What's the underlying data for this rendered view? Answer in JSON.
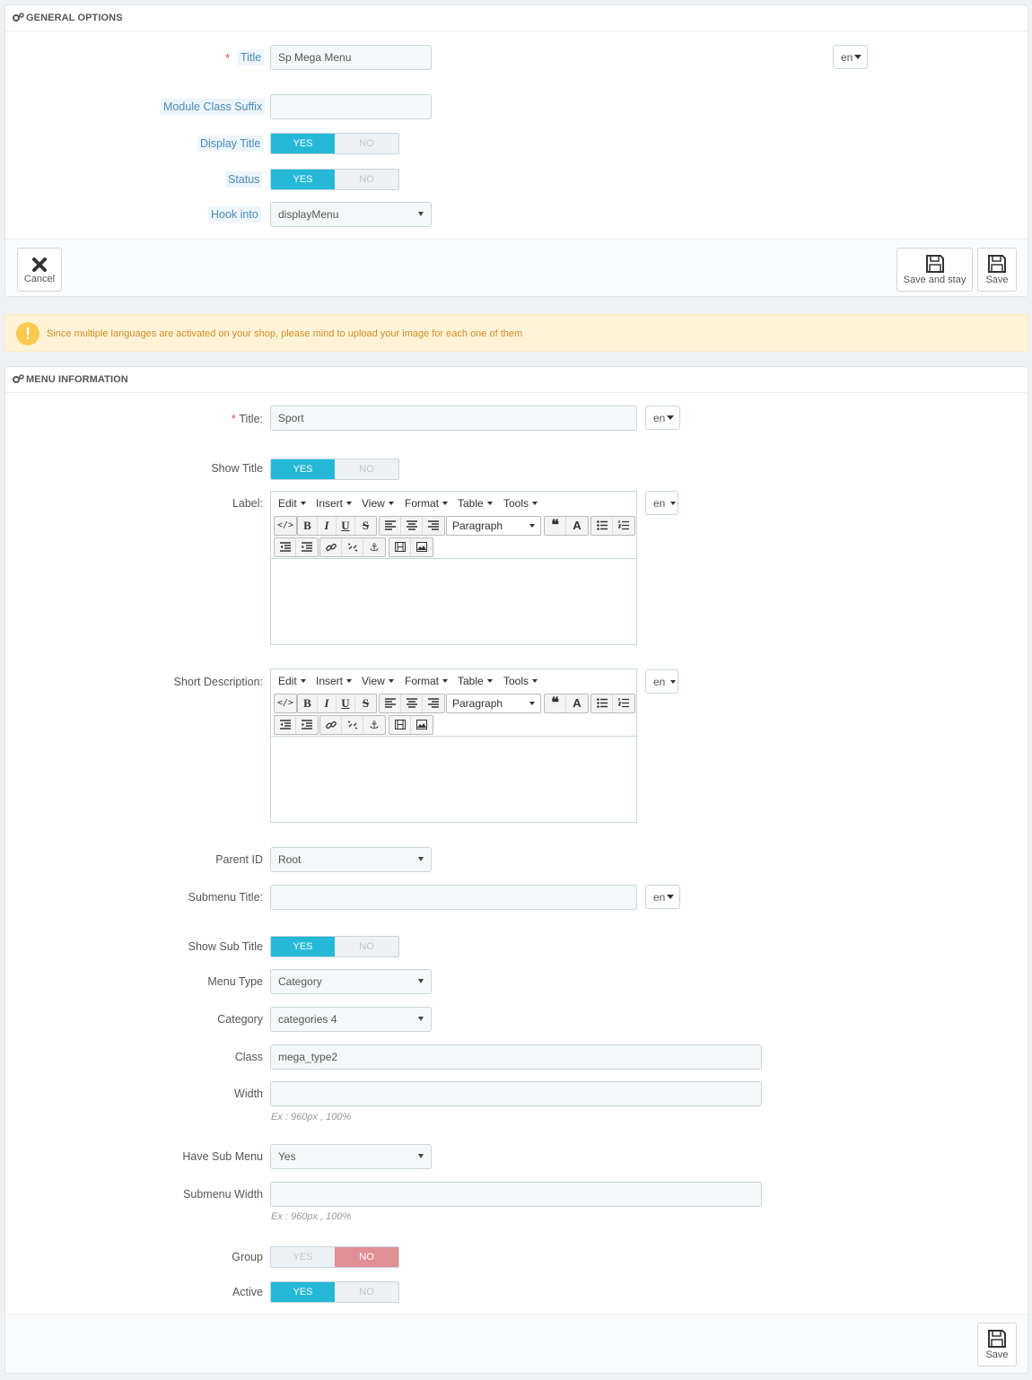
{
  "general_options": {
    "heading": "GENERAL OPTIONS",
    "title_label": "Title",
    "title_value": "Sp Mega Menu",
    "lang": "en",
    "module_class_suffix_label": "Module Class Suffix",
    "module_class_suffix_value": "",
    "display_title_label": "Display Title",
    "display_title": "YES",
    "status_label": "Status",
    "status": "YES",
    "hook_into_label": "Hook into",
    "hook_into_value": "displayMenu",
    "cancel_label": "Cancel",
    "save_and_stay_label": "Save and stay",
    "save_label": "Save"
  },
  "switch": {
    "yes": "YES",
    "no": "NO"
  },
  "alert": {
    "text": "Since multiple languages are activated on your shop, please mind to upload your image for each one of them"
  },
  "menu_information": {
    "heading": "MENU INFORMATION",
    "title_label": "Title:",
    "title_value": "Sport",
    "lang": "en",
    "show_title_label": "Show Title",
    "show_title": "YES",
    "label_label": "Label:",
    "short_description_label": "Short Description:",
    "parent_id_label": "Parent ID",
    "parent_id_value": "Root",
    "submenu_title_label": "Submenu Title:",
    "submenu_title_value": "",
    "show_sub_title_label": "Show Sub Title",
    "show_sub_title": "YES",
    "menu_type_label": "Menu Type",
    "menu_type_value": "Category",
    "category_label": "Category",
    "category_value": "categories 4",
    "class_label": "Class",
    "class_value": "mega_type2",
    "width_label": "Width",
    "width_value": "",
    "width_help": "Ex : 960px , 100%",
    "have_sub_menu_label": "Have Sub Menu",
    "have_sub_menu_value": "Yes",
    "submenu_width_label": "Submenu Width",
    "submenu_width_value": "",
    "submenu_width_help": "Ex : 960px , 100%",
    "group_label": "Group",
    "group": "NO",
    "active_label": "Active",
    "active": "YES",
    "save_label": "Save"
  },
  "editor": {
    "menus": [
      "Edit",
      "Insert",
      "View",
      "Format",
      "Table",
      "Tools"
    ],
    "format_select": "Paragraph",
    "icons": [
      "source-code-icon",
      "bold-icon",
      "italic-icon",
      "underline-icon",
      "strikethrough-icon",
      "align-left-icon",
      "align-center-icon",
      "align-right-icon",
      "blockquote-icon",
      "text-color-icon",
      "bullet-list-icon",
      "numbered-list-icon",
      "outdent-icon",
      "indent-icon",
      "link-icon",
      "unlink-icon",
      "anchor-icon",
      "media-icon",
      "image-icon"
    ]
  },
  "colors": {
    "switch_on": "#25b9d7",
    "switch_no_on": "#e08f95",
    "required": "#e04b4b",
    "alert_bg": "#fff3d7",
    "alert_text": "#d28d23"
  }
}
